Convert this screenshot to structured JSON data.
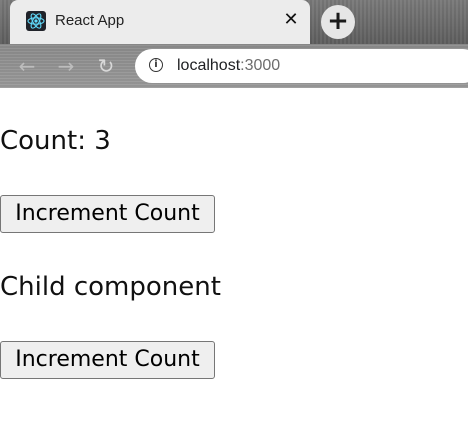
{
  "browser": {
    "tab_title": "React App",
    "tab_icon": "react-logo-icon",
    "close_glyph": "✕",
    "new_tab_glyph": "+",
    "url_host": "localhost",
    "url_port": ":3000",
    "nav": {
      "back_glyph": "←",
      "forward_glyph": "→",
      "reload_glyph": "↻"
    },
    "info_glyph": "i"
  },
  "app": {
    "count_text": "Count: 3",
    "increment_label": "Increment Count",
    "child_heading": "Child component",
    "child_increment_label": "Increment Count"
  },
  "colors": {
    "react_cyan": "#61dafb",
    "button_bg": "#efefef",
    "button_border": "#767676"
  }
}
